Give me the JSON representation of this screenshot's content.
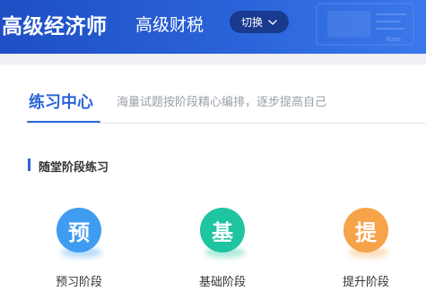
{
  "header": {
    "title": "高级经济师",
    "subtitle": "高级财税",
    "switch_label": "切换",
    "banner_bg_text": "Rate",
    "colors": {
      "banner": "#2a63d9",
      "switch_bg": "#1a3a8f"
    }
  },
  "section": {
    "title": "练习中心",
    "description": "海量试题按阶段精心编排，逐步提高自己",
    "accent_color": "#2a63d9"
  },
  "subsection": {
    "title": "随堂阶段练习"
  },
  "stages": [
    {
      "glyph": "预",
      "label": "预习阶段",
      "color": "#3f9cf0"
    },
    {
      "glyph": "基",
      "label": "基础阶段",
      "color": "#1fc4a0"
    },
    {
      "glyph": "提",
      "label": "提升阶段",
      "color": "#f7a34a"
    }
  ]
}
